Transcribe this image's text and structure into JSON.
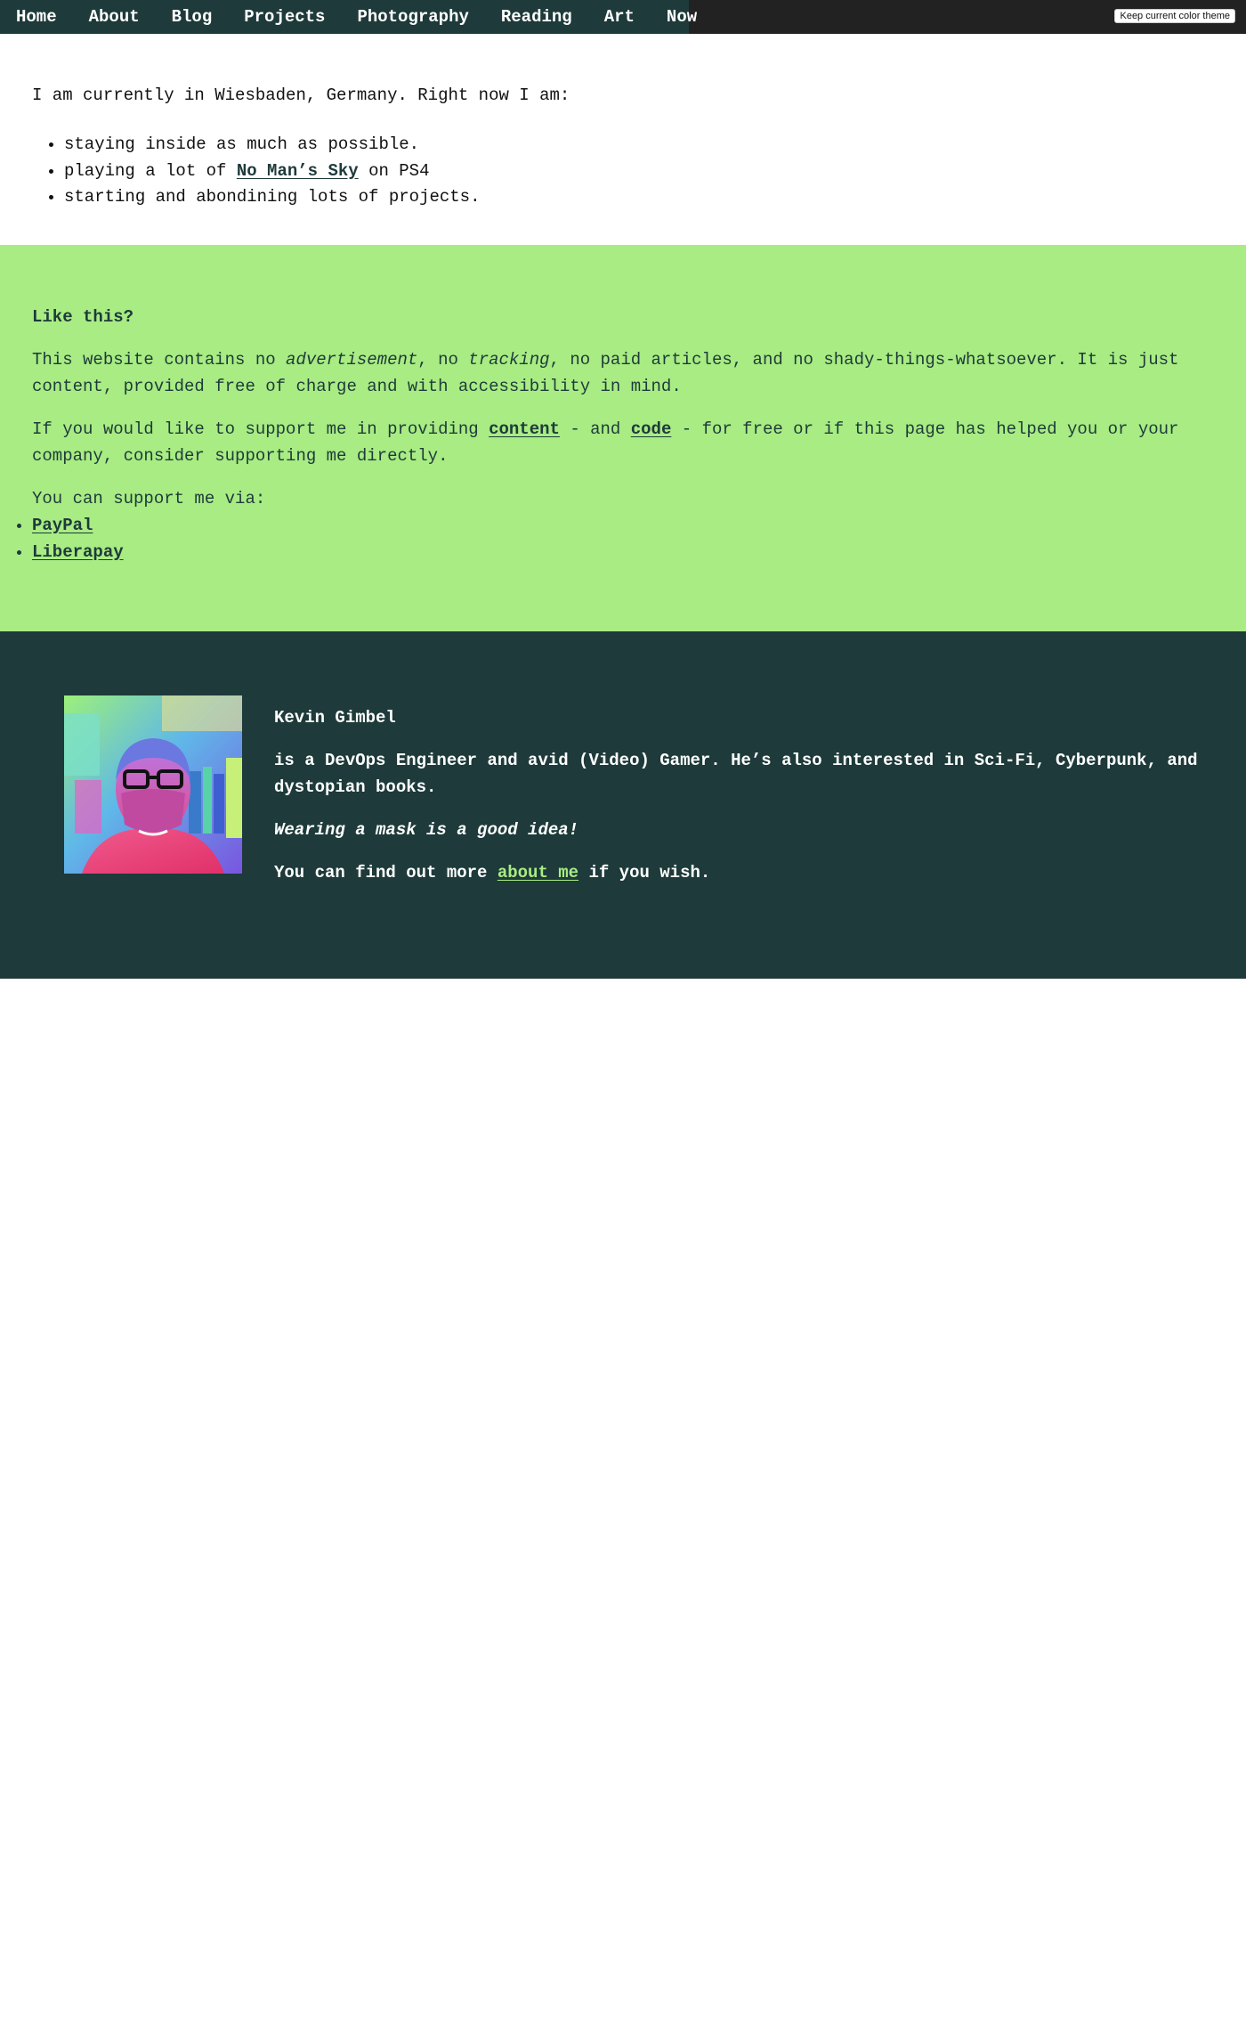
{
  "nav": {
    "items": [
      "Home",
      "About",
      "Blog",
      "Projects",
      "Photography",
      "Reading",
      "Art",
      "Now"
    ],
    "theme_button": "Keep current color theme"
  },
  "now": {
    "intro": "I am currently in Wiesbaden, Germany. Right now I am:",
    "items": {
      "staying": "staying inside as much as possible.",
      "playing_prefix": "playing a lot of ",
      "playing_link": "No Man’s Sky",
      "playing_suffix": " on PS4",
      "starting": "starting and abondining lots of projects."
    }
  },
  "support": {
    "heading": "Like this?",
    "p1_a": "This website contains no ",
    "p1_em1": "advertisement",
    "p1_b": ", no ",
    "p1_em2": "tracking",
    "p1_c": ", no paid articles, and no shady-things-whatsoever. It is just content, provided free of charge and with accessibility in mind.",
    "p2_a": "If you would like to support me in providing ",
    "p2_link1": "content",
    "p2_b": " - and ",
    "p2_link2": "code",
    "p2_c": " - for free or if this page has helped you or your company, consider supporting me directly.",
    "via": "You can support me via:",
    "links": [
      "PayPal",
      "Liberapay"
    ]
  },
  "author": {
    "name": "Kevin Gimbel",
    "role_bold": "is a DevOps Engineer and avid (Video) Gamer.",
    "role_rest": " He’s also interested in Sci-Fi, Cyberpunk, and dystopian books.",
    "mask": "Wearing a mask is a good idea!",
    "more_prefix": "You can find out more ",
    "more_link": "about me",
    "more_suffix": " if you wish."
  },
  "colors": {
    "nav_bg": "#1e3a3a",
    "topbar_bg": "#222222",
    "support_bg": "#a8ec83",
    "author_bg": "#1e3a3a",
    "accent_link": "#a8ec83"
  }
}
